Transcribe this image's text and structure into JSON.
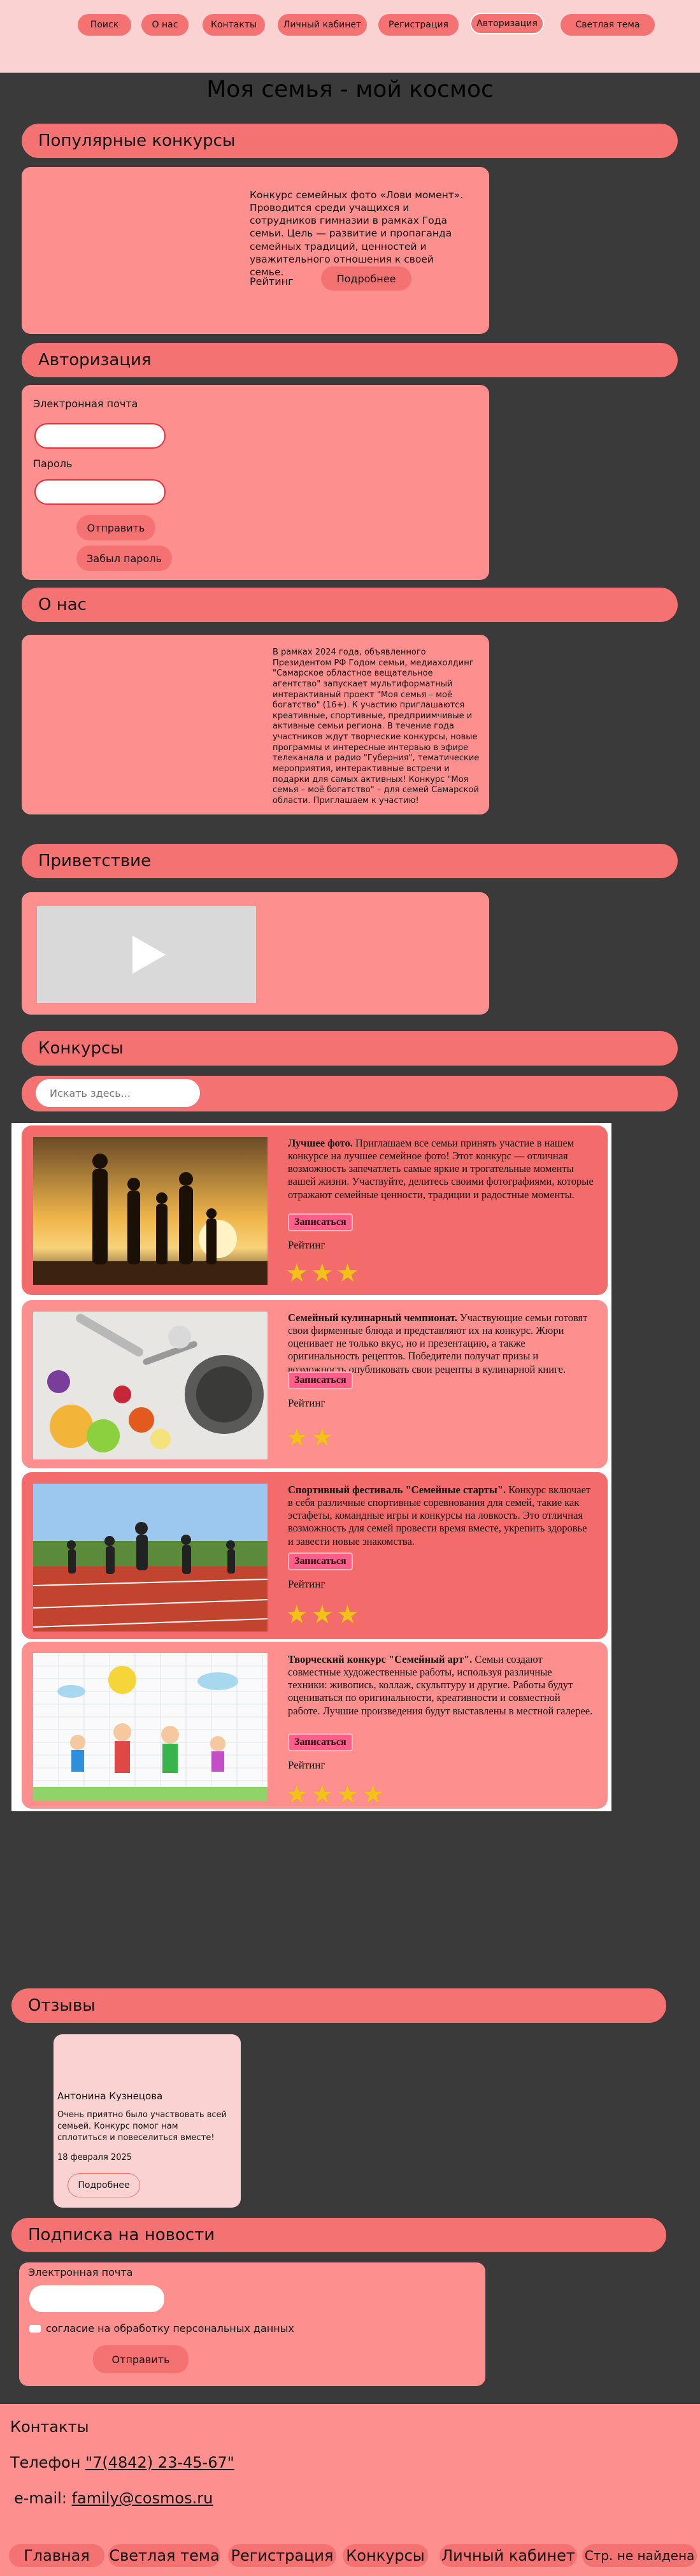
{
  "nav": {
    "items": [
      "Поиск",
      "О нас",
      "Контакты",
      "Личный кабинет",
      "Регистрация",
      "Авторизация",
      "Светлая тема"
    ]
  },
  "page_title": "Моя семья - мой космос",
  "popular": {
    "heading": "Популярные конкурсы",
    "description": "Конкурс семейных фото «Лови момент». Проводится среди учащихся и сотрудников гимназии в рамках Года семьи. Цель — развитие и пропаганда семейных традиций, ценностей и уважительного отношения к своей семье.",
    "rating_label": "Рейтинг",
    "button": "Подробнее"
  },
  "auth": {
    "heading": "Авторизация",
    "email_label": "Электронная почта",
    "password_label": "Пароль",
    "submit": "Отправить",
    "forgot": "Забыл пароль"
  },
  "about": {
    "heading": "О нас",
    "text": "В рамках 2024 года, объявленного Президентом РФ Годом семьи, медиахолдинг \"Самарское областное вещательное агентство\" запускает мультиформатный интерактивный проект \"Моя семья – моё богатство\" (16+). К участию приглашаются креативные, спортивные, предприимчивые и активные семьи региона. В течение года участников ждут творческие конкурсы, новые программы и интересные интервью в эфире телеканала и радио \"Губерния\", тематические мероприятия, интерактивные встречи и подарки для самых активных! Конкурс \"Моя семья – моё богатство\" – для семей Самарской области. Приглашаем к участию!"
  },
  "greeting": {
    "heading": "Приветствие",
    "video_icon": "play-icon"
  },
  "contests": {
    "heading": "Конкурсы",
    "search_placeholder": "Искать здесь...",
    "signup_label": "Записаться",
    "rating_label": "Рейтинг",
    "items": [
      {
        "title": "Лучшее фото.",
        "text": " Приглашаем все семьи принять участие в нашем конкурсе на лучшее семейное фото! Этот конкурс — отличная возможность запечатлеть самые яркие и трогательные моменты вашей жизни. Участвуйте, делитесь своими фотографиями, которые отражают семейные ценности, традиции и радостные моменты.",
        "stars": "★★★",
        "color": "#f36b6b"
      },
      {
        "title": "Семейный кулинарный чемпионат.",
        "text": " Участвующие семьи готовят свои фирменные блюда и представляют их на конкурс. Жюри оценивает не только вкус, но и презентацию, а также оригинальность рецептов. Победители получат призы и возможность опубликовать свои рецепты в кулинарной книге.",
        "stars": "★★",
        "color": "#fe8f8f"
      },
      {
        "title": "Спортивный фестиваль \"Семейные старты\".",
        "text": " Конкурс включает в себя различные спортивные соревнования для семей, такие как эстафеты, командные игры и конкурсы на ловкость. Это отличная возможность для семей провести время вместе, укрепить здоровье и завести новые знакомства.",
        "stars": "★★★",
        "color": "#f36b6b"
      },
      {
        "title": "Творческий конкурс \"Семейный арт\".",
        "text": " Семьи создают совместные художественные работы, используя различные техники: живопись, коллаж, скульптуру и другие. Работы будут оцениваться по оригинальности, креативности и совместной работе. Лучшие произведения будут выставлены в местной галерее.",
        "stars": "★★★★",
        "color": "#fe8f8f"
      }
    ]
  },
  "reviews": {
    "heading": "Отзывы",
    "author": "Антонина Кузнецова",
    "text": "Очень приятно было участвовать всей семьей. Конкурс помог нам сплотиться и повеселиться вместе!",
    "date": "18 февраля 2025",
    "button": "Подробнее"
  },
  "subscribe": {
    "heading": "Подписка на новости",
    "email_label": "Электронная почта",
    "consent": "согласие на обработку персональных данных",
    "submit": "Отправить"
  },
  "footer": {
    "contacts_title": "Контакты",
    "phone_label": "Телефон ",
    "phone": "\"7(4842) 23-45-67\"",
    "email_label": "e-mail: ",
    "email": "family@cosmos.ru",
    "links": [
      "Главная",
      "Светлая тема",
      "Регистрация",
      "Конкурсы",
      "Личный кабинет",
      "Стр. не найдена"
    ]
  },
  "colors": {
    "background": "#3a3a3a",
    "accent": "#f47272",
    "panel": "#fe8f8f",
    "header": "#fbd2d2",
    "star": "#f2c21b"
  }
}
